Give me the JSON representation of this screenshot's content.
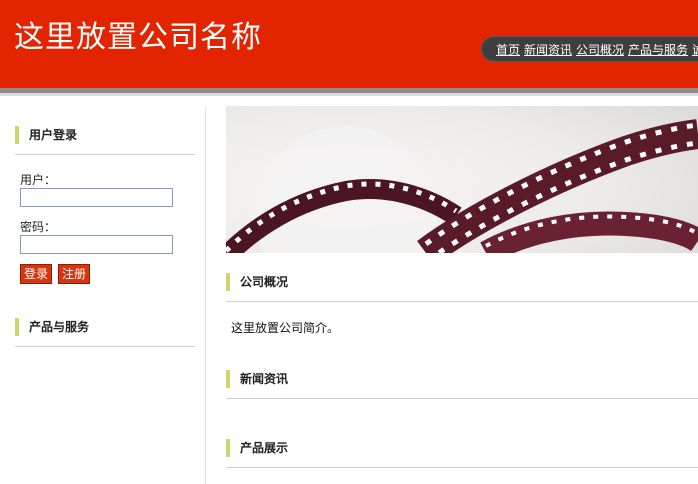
{
  "header": {
    "site_title": "这里放置公司名称",
    "nav": [
      "首页",
      "新闻资讯",
      "公司概况",
      "产品与服务",
      "诚"
    ]
  },
  "sidebar": {
    "login": {
      "title": "用户登录",
      "user_label": "用户：",
      "password_label": "密码：",
      "user_value": "",
      "password_value": "",
      "login_button": "登录",
      "register_button": "注册"
    },
    "products_title": "产品与服务"
  },
  "main": {
    "banner_icon": "film-strip-image",
    "sections": {
      "about_title": "公司概况",
      "about_text": "这里放置公司简介。",
      "news_title": "新闻资讯",
      "products_title": "产品展示"
    }
  },
  "colors": {
    "header_bg": "#e22400",
    "accent_bar": "#cfd56a",
    "button_bg": "#d7350f",
    "nav_bg": "#3e3e3e"
  }
}
